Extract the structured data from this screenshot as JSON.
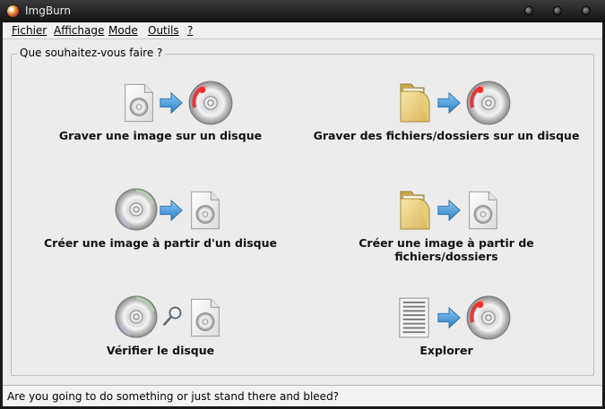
{
  "window": {
    "title": "ImgBurn"
  },
  "menu": [
    {
      "label": "Fichier"
    },
    {
      "label": "Affichage"
    },
    {
      "label": "Mode"
    },
    {
      "label": "Outils"
    },
    {
      "label": "?"
    }
  ],
  "group": {
    "label": "Que souhaitez-vous faire ?"
  },
  "actions": [
    {
      "label": "Graver une image sur un disque",
      "icons": [
        "image-file-icon",
        "arrow-right-icon",
        "burn-disc-icon"
      ]
    },
    {
      "label": "Graver des fichiers/dossiers sur un disque",
      "icons": [
        "folder-icon",
        "arrow-right-icon",
        "burn-disc-icon"
      ]
    },
    {
      "label": "Créer une image à partir d'un disque",
      "icons": [
        "disc-icon",
        "arrow-right-icon",
        "image-file-icon"
      ]
    },
    {
      "label": "Créer une image à partir de fichiers/dossiers",
      "icons": [
        "folder-icon",
        "arrow-right-icon",
        "image-file-icon"
      ]
    },
    {
      "label": "Vérifier le disque",
      "icons": [
        "disc-icon",
        "magnifier-icon",
        "image-file-icon"
      ]
    },
    {
      "label": "Explorer",
      "icons": [
        "binary-data-file-icon",
        "arrow-right-icon",
        "burn-disc-icon"
      ]
    }
  ],
  "status": {
    "text": "Are you going to do something or just stand there and bleed?"
  },
  "colors": {
    "titlebar": "#1f1f1f",
    "arrow": "#3a8fd9",
    "burn_red": "#d92b2b"
  }
}
